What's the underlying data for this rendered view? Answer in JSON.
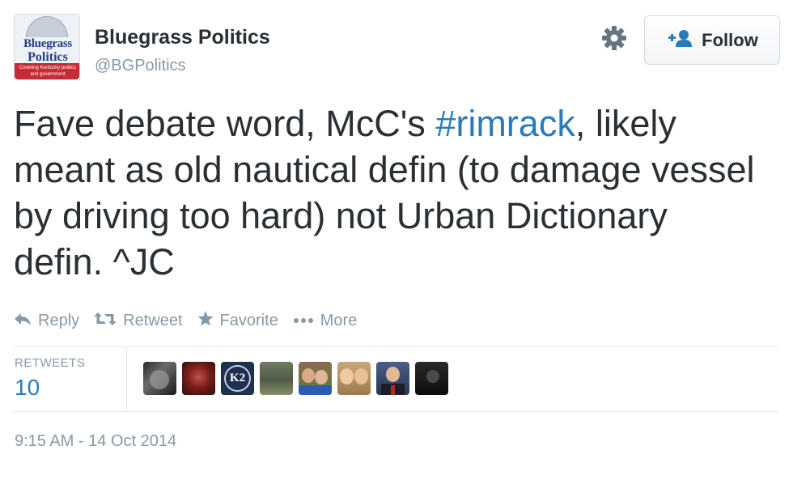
{
  "account": {
    "display_name": "Bluegrass Politics",
    "handle": "@BGPolitics",
    "avatar_text": {
      "line1": "Bluegrass",
      "line2": "Politics",
      "tagline": "Covering Kentucky politics and government"
    }
  },
  "follow_button": {
    "label": "Follow",
    "icon": "add-user-icon"
  },
  "settings_icon": "gear-icon",
  "tweet": {
    "text_before": "Fave debate word, McC's ",
    "hashtag": "#rimrack",
    "text_after": ", likely meant as old nautical defin (to damage vessel by driving too hard) not Urban Dictionary defin. ^JC"
  },
  "actions": [
    {
      "label": "Reply",
      "icon": "reply-icon"
    },
    {
      "label": "Retweet",
      "icon": "retweet-icon"
    },
    {
      "label": "Favorite",
      "icon": "star-icon"
    },
    {
      "label": "More",
      "icon": "more-dots-icon"
    }
  ],
  "stats": {
    "retweets_label": "RETWEETS",
    "retweets_count": "10"
  },
  "retweeters": [
    {
      "avatar": "photo"
    },
    {
      "avatar": "photo"
    },
    {
      "avatar": "logo",
      "text": "K2"
    },
    {
      "avatar": "photo"
    },
    {
      "avatar": "photo"
    },
    {
      "avatar": "photo"
    },
    {
      "avatar": "photo"
    },
    {
      "avatar": "photo"
    }
  ],
  "timestamp": "9:15 AM - 14 Oct 2014",
  "colors": {
    "link": "#2b7bb9",
    "muted": "#8899a6",
    "text": "#292f33",
    "divider": "#e1e8ed"
  }
}
